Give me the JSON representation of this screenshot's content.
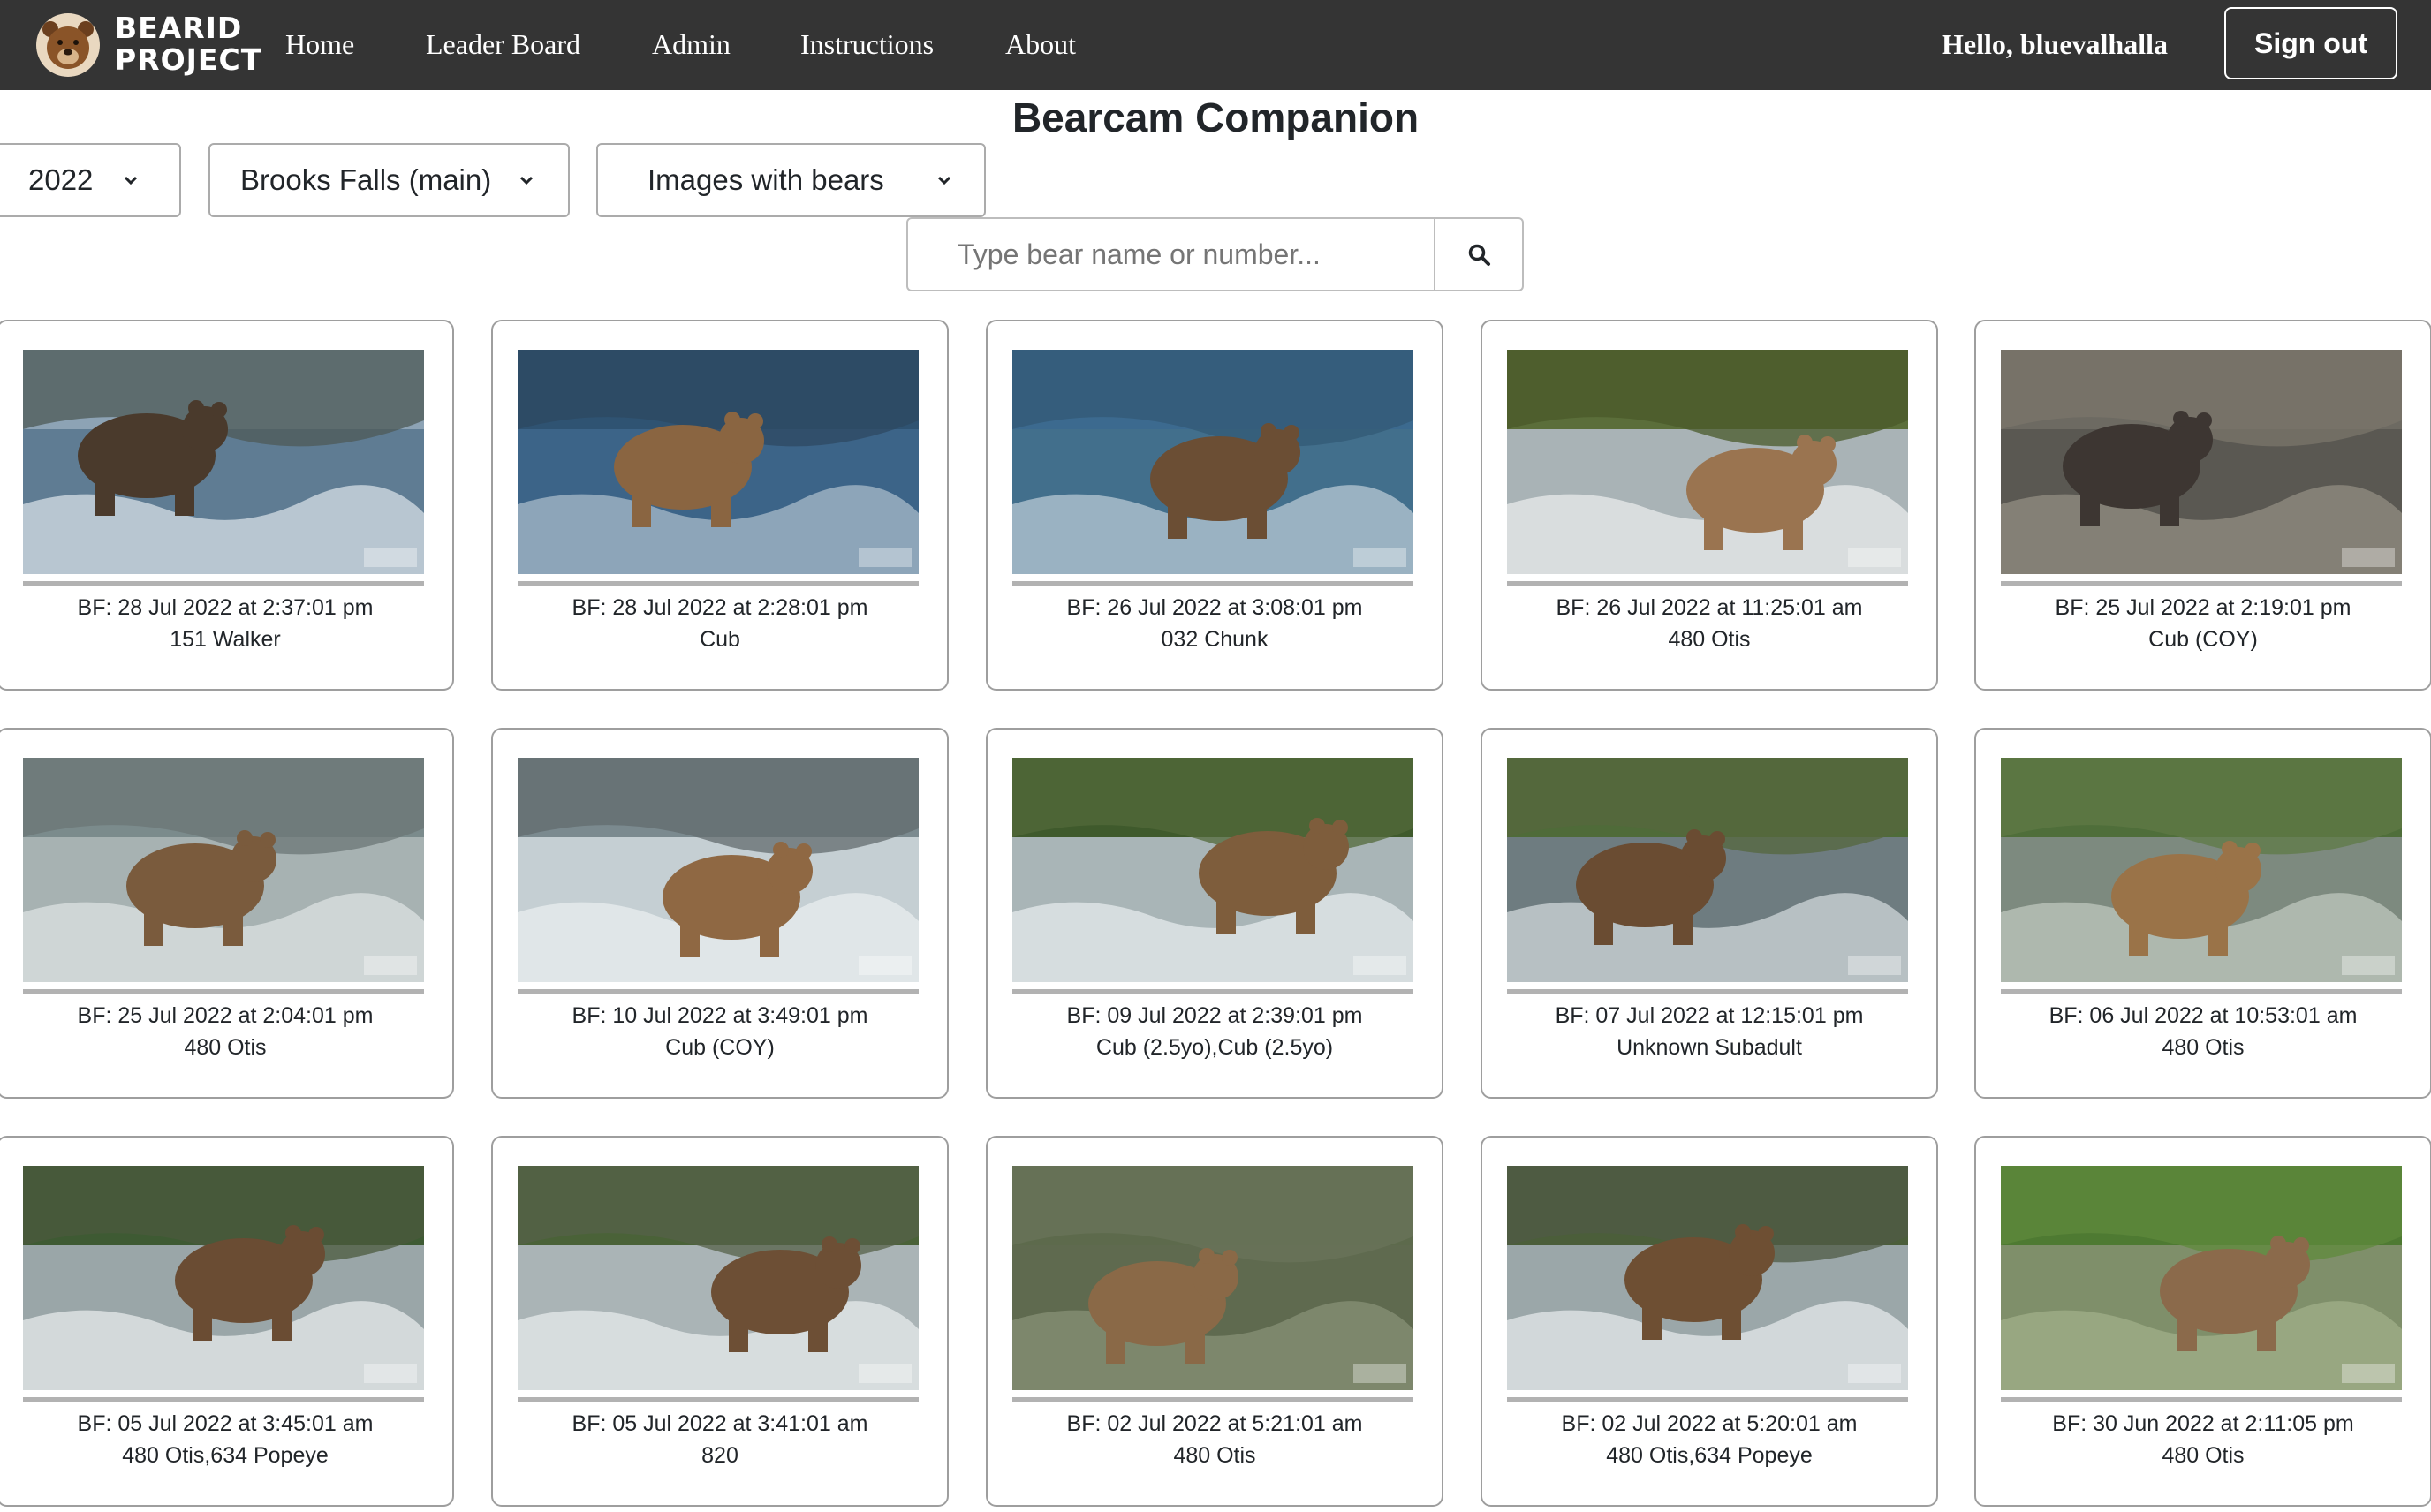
{
  "navbar": {
    "logo_line1": "BEARID",
    "logo_line2": "PROJECT",
    "links": [
      "Home",
      "Leader Board",
      "Admin",
      "Instructions",
      "About"
    ],
    "greeting": "Hello, bluevalhalla",
    "signout_label": "Sign out"
  },
  "page": {
    "title": "Bearcam Companion"
  },
  "filters": {
    "year": "2022",
    "camera": "Brooks Falls (main)",
    "image_filter": "Images with bears"
  },
  "search": {
    "placeholder": "Type bear name or number...",
    "icon": "search-icon"
  },
  "cards": [
    {
      "timestamp": "BF: 28 Jul 2022 at 2:37:01 pm",
      "bears": "151 Walker"
    },
    {
      "timestamp": "BF: 28 Jul 2022 at 2:28:01 pm",
      "bears": "Cub"
    },
    {
      "timestamp": "BF: 26 Jul 2022 at 3:08:01 pm",
      "bears": "032 Chunk"
    },
    {
      "timestamp": "BF: 26 Jul 2022 at 11:25:01 am",
      "bears": "480 Otis"
    },
    {
      "timestamp": "BF: 25 Jul 2022 at 2:19:01 pm",
      "bears": "Cub (COY)"
    },
    {
      "timestamp": "BF: 25 Jul 2022 at 2:04:01 pm",
      "bears": "480 Otis"
    },
    {
      "timestamp": "BF: 10 Jul 2022 at 3:49:01 pm",
      "bears": "Cub (COY)"
    },
    {
      "timestamp": "BF: 09 Jul 2022 at 2:39:01 pm",
      "bears": "Cub (2.5yo),Cub (2.5yo)"
    },
    {
      "timestamp": "BF: 07 Jul 2022 at 12:15:01 pm",
      "bears": "Unknown Subadult"
    },
    {
      "timestamp": "BF: 06 Jul 2022 at 10:53:01 am",
      "bears": "480 Otis"
    },
    {
      "timestamp": "BF: 05 Jul 2022 at 3:45:01 am",
      "bears": "480 Otis,634 Popeye"
    },
    {
      "timestamp": "BF: 05 Jul 2022 at 3:41:01 am",
      "bears": "820"
    },
    {
      "timestamp": "BF: 02 Jul 2022 at 5:21:01 am",
      "bears": "480 Otis"
    },
    {
      "timestamp": "BF: 02 Jul 2022 at 5:20:01 am",
      "bears": "480 Otis,634 Popeye"
    },
    {
      "timestamp": "BF: 30 Jun 2022 at 2:11:05 pm",
      "bears": "480 Otis"
    }
  ]
}
